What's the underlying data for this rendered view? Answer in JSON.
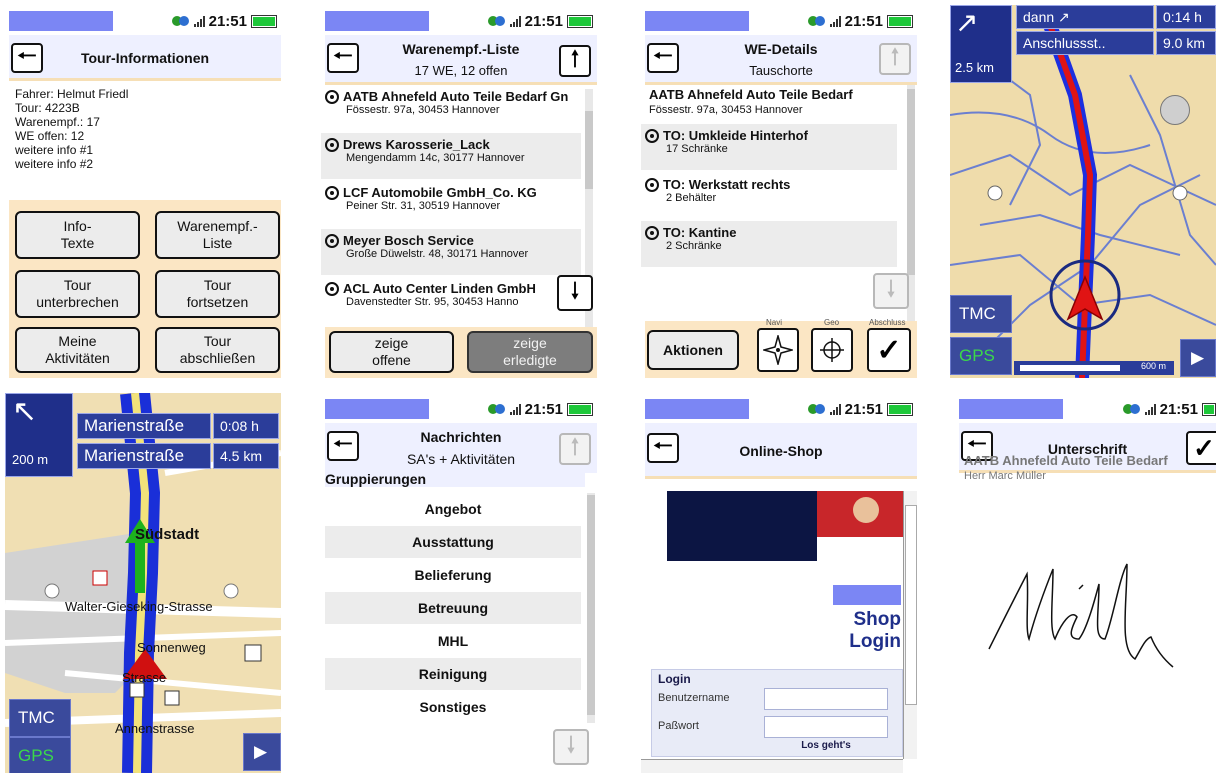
{
  "status": {
    "time": "21:51"
  },
  "s1": {
    "title": "Tour-Informationen",
    "info": [
      "Fahrer: Helmut Friedl",
      "Tour: 4223B",
      "Warenempf.: 17",
      "WE offen: 12",
      "weitere info #1",
      "weitere info #2"
    ],
    "buttons": [
      {
        "l1": "Info-",
        "l2": "Texte"
      },
      {
        "l1": "Warenempf.-",
        "l2": "Liste"
      },
      {
        "l1": "Tour",
        "l2": "unterbrechen"
      },
      {
        "l1": "Tour",
        "l2": "fortsetzen"
      },
      {
        "l1": "Meine",
        "l2": "Aktivitäten"
      },
      {
        "l1": "Tour",
        "l2": "abschließen"
      }
    ]
  },
  "s2": {
    "title": "Warenempf.-Liste",
    "subtitle": "17 WE, 12 offen",
    "items": [
      {
        "name": "AATB Ahnefeld Auto Teile Bedarf Gn",
        "addr": "Fössestr. 97a, 30453 Hannover"
      },
      {
        "name": "Drews Karosserie_Lack",
        "addr": "Mengendamm 14c, 30177 Hannover"
      },
      {
        "name": "LCF Automobile GmbH_Co. KG",
        "addr": "Peiner Str. 31, 30519 Hannover"
      },
      {
        "name": "Meyer Bosch Service",
        "addr": "Große Düwelstr. 48, 30171 Hannover"
      },
      {
        "name": "ACL Auto Center Linden GmbH",
        "addr": "Davenstedter Str. 95, 30453 Hanno"
      }
    ],
    "btn_open": {
      "l1": "zeige",
      "l2": "offene"
    },
    "btn_done": {
      "l1": "zeige",
      "l2": "erledigte"
    }
  },
  "s3": {
    "title": "WE-Details",
    "subtitle": "Tauschorte",
    "company": "AATB Ahnefeld Auto Teile Bedarf",
    "address": "Fössestr. 97a, 30453 Hannover",
    "items": [
      {
        "name": "TO: Umkleide Hinterhof",
        "detail": "17 Schränke"
      },
      {
        "name": "TO: Werkstatt rechts",
        "detail": "2 Behälter"
      },
      {
        "name": "TO: Kantine",
        "detail": "2 Schränke"
      }
    ],
    "actions_label": "Aktionen",
    "tool_labels": [
      "Navi",
      "Geo",
      "Abschluss"
    ]
  },
  "s4": {
    "then_label": "dann",
    "street": "Anschlussst..",
    "time": "0:14 h",
    "distance": "9.0 km",
    "turn_distance": "2.5 km",
    "tmc": "TMC",
    "gps": "GPS",
    "scale": "600 m"
  },
  "s5": {
    "street1": "Marienstraße",
    "street2": "Marienstraße",
    "time": "0:08 h",
    "distance": "4.5 km",
    "turn_distance": "200 m",
    "labels": [
      "Südstadt",
      "Walter-Gieseking-Strasse",
      "Sonnenweg",
      "Strasse",
      "Annenstrasse"
    ],
    "tmc": "TMC",
    "gps": "GPS"
  },
  "s6": {
    "title": "Nachrichten",
    "subtitle": "SA's + Aktivitäten",
    "group_label": "Gruppierungen",
    "items": [
      "Angebot",
      "Ausstattung",
      "Belieferung",
      "Betreuung",
      "MHL",
      "Reinigung",
      "Sonstiges"
    ]
  },
  "s7": {
    "title": "Online-Shop",
    "shop_line1": "Shop",
    "shop_line2": "Login",
    "login_title": "Login",
    "user_label": "Benutzername",
    "pass_label": "Paßwort",
    "submit": "Los geht's"
  },
  "s8": {
    "title": "Unterschrift",
    "company": "AATB Ahnefeld Auto Teile Bedarf",
    "person": "Herr Marc Müller"
  }
}
